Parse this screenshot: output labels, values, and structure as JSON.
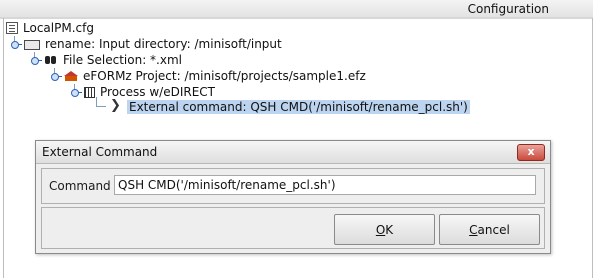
{
  "panel": {
    "title": "Configuration"
  },
  "tree": {
    "root": "LocalPM.cfg",
    "rename": "rename: Input directory: /minisoft/input",
    "file_selection": "File Selection: *.xml",
    "project": "eFORMz Project: /minisoft/projects/sample1.efz",
    "process": "Process w/eDIRECT",
    "external": "External command: QSH CMD('/minisoft/rename_pcl.sh')"
  },
  "dialog": {
    "title": "External Command",
    "close_label": "x",
    "command_label": "Command",
    "command_value": "QSH CMD('/minisoft/rename_pcl.sh')",
    "ok_mnemonic": "O",
    "ok_rest": "K",
    "cancel_mnemonic": "C",
    "cancel_rest": "ancel"
  },
  "icons": {
    "root": "config-tree-icon",
    "rename": "folder-icon",
    "file_selection": "binoculars-icon",
    "project": "project-icon",
    "process": "process-icon",
    "external": "chevron-right-icon"
  }
}
